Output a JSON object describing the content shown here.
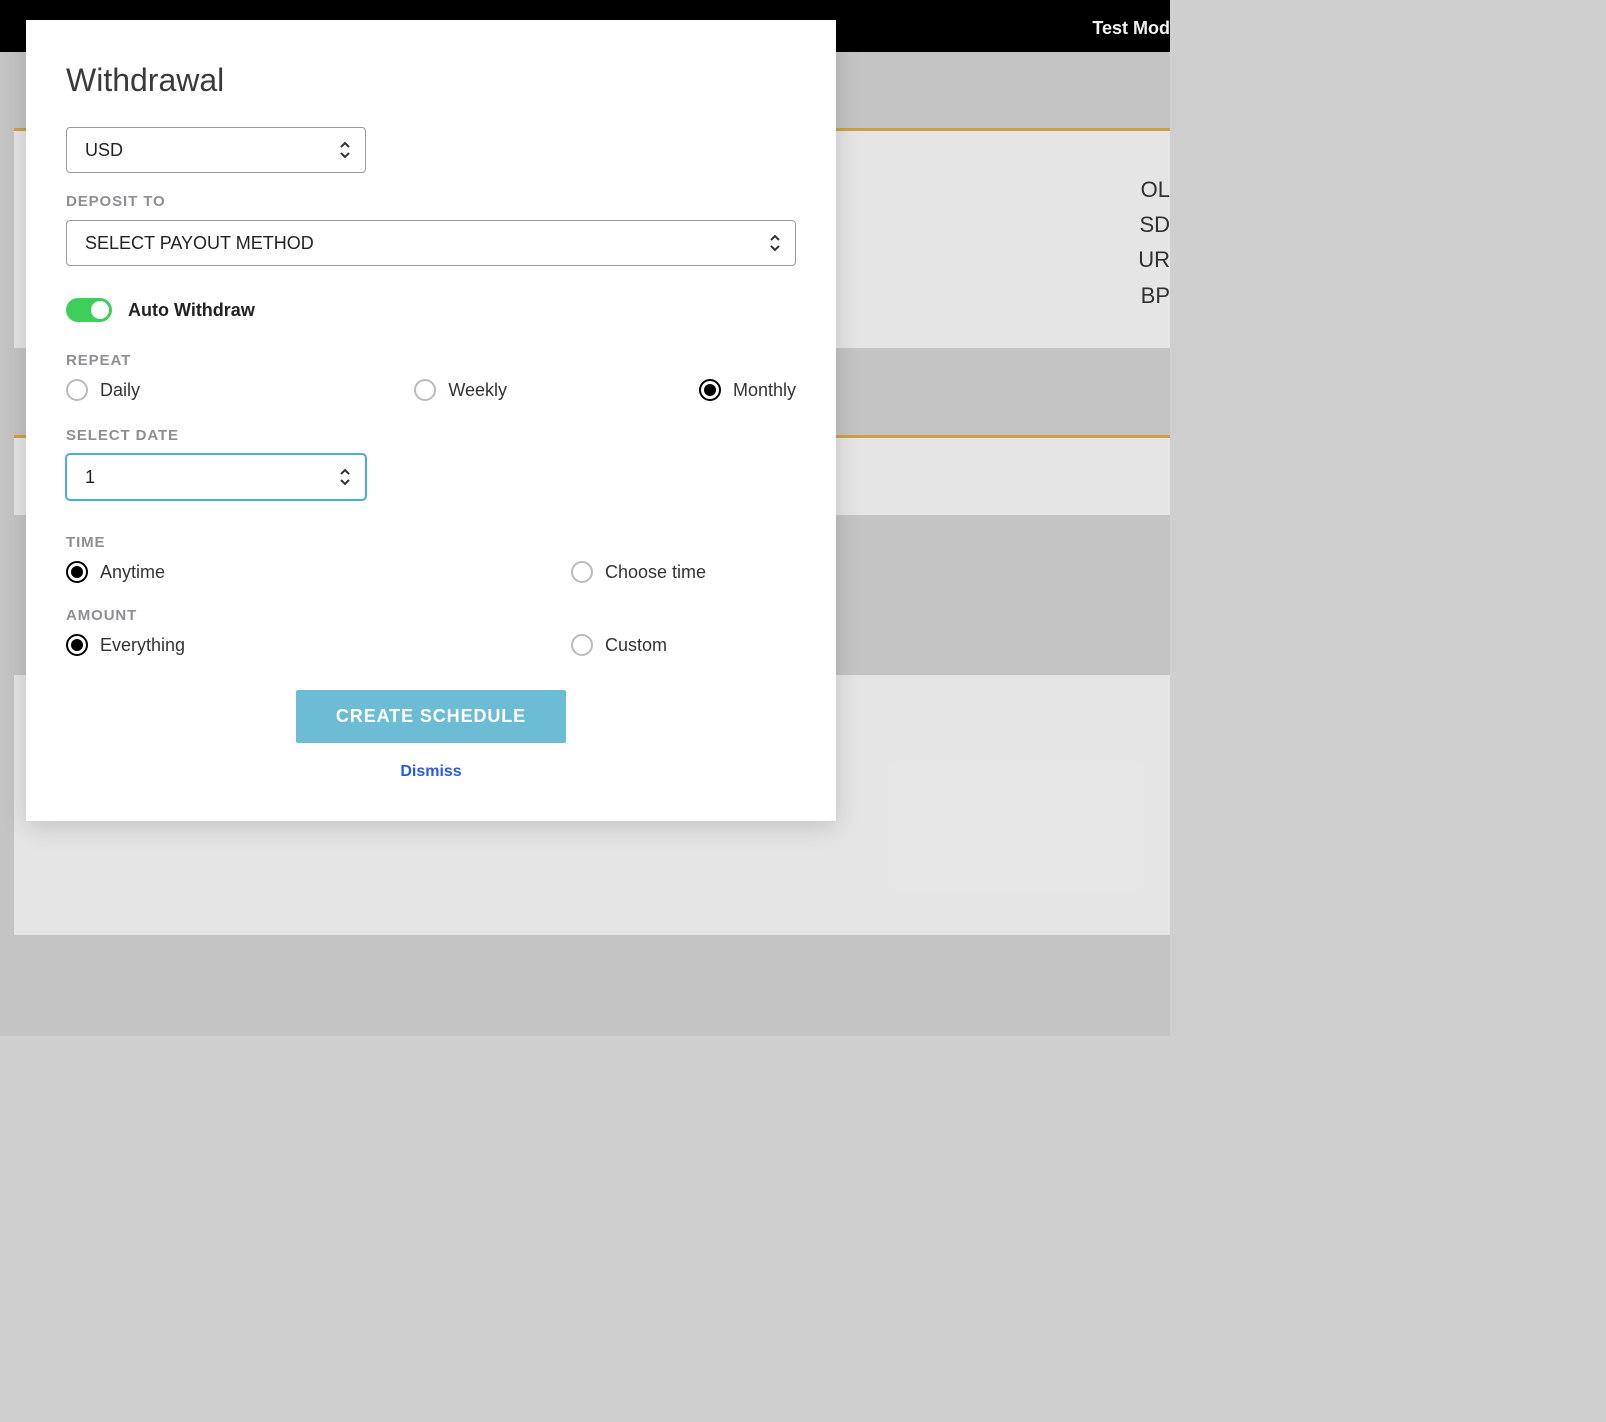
{
  "topbar": {
    "mode_label": "Test Mod"
  },
  "background": {
    "right_labels": [
      "OL",
      "SD",
      "UR",
      "BP"
    ]
  },
  "modal": {
    "title": "Withdrawal",
    "currency_select": {
      "value": "USD"
    },
    "deposit_to": {
      "label": "DEPOSIT TO",
      "value": "SELECT PAYOUT METHOD"
    },
    "auto_withdraw": {
      "label": "Auto Withdraw",
      "on": true
    },
    "repeat": {
      "label": "REPEAT",
      "options": [
        {
          "label": "Daily",
          "checked": false
        },
        {
          "label": "Weekly",
          "checked": false
        },
        {
          "label": "Monthly",
          "checked": true
        }
      ]
    },
    "select_date": {
      "label": "SELECT DATE",
      "value": "1"
    },
    "time": {
      "label": "TIME",
      "options": [
        {
          "label": "Anytime",
          "checked": true
        },
        {
          "label": "Choose time",
          "checked": false
        }
      ]
    },
    "amount": {
      "label": "AMOUNT",
      "options": [
        {
          "label": "Everything",
          "checked": true
        },
        {
          "label": "Custom",
          "checked": false
        }
      ]
    },
    "actions": {
      "primary": "CREATE SCHEDULE",
      "dismiss": "Dismiss"
    }
  }
}
